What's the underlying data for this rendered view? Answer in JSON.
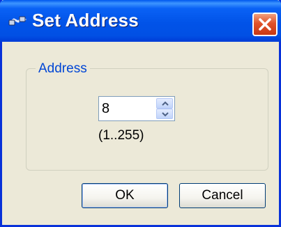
{
  "window": {
    "title": "Set Address",
    "icon": "network-cable-icon",
    "close_icon": "close-icon"
  },
  "group": {
    "legend": "Address"
  },
  "address_field": {
    "value": "8",
    "range_hint": "(1..255)"
  },
  "buttons": {
    "ok_label": "OK",
    "cancel_label": "Cancel"
  },
  "colors": {
    "titlebar": "#0153e8",
    "close_button": "#e0522a",
    "legend_text": "#0046d5",
    "dialog_bg": "#ece9d8"
  }
}
